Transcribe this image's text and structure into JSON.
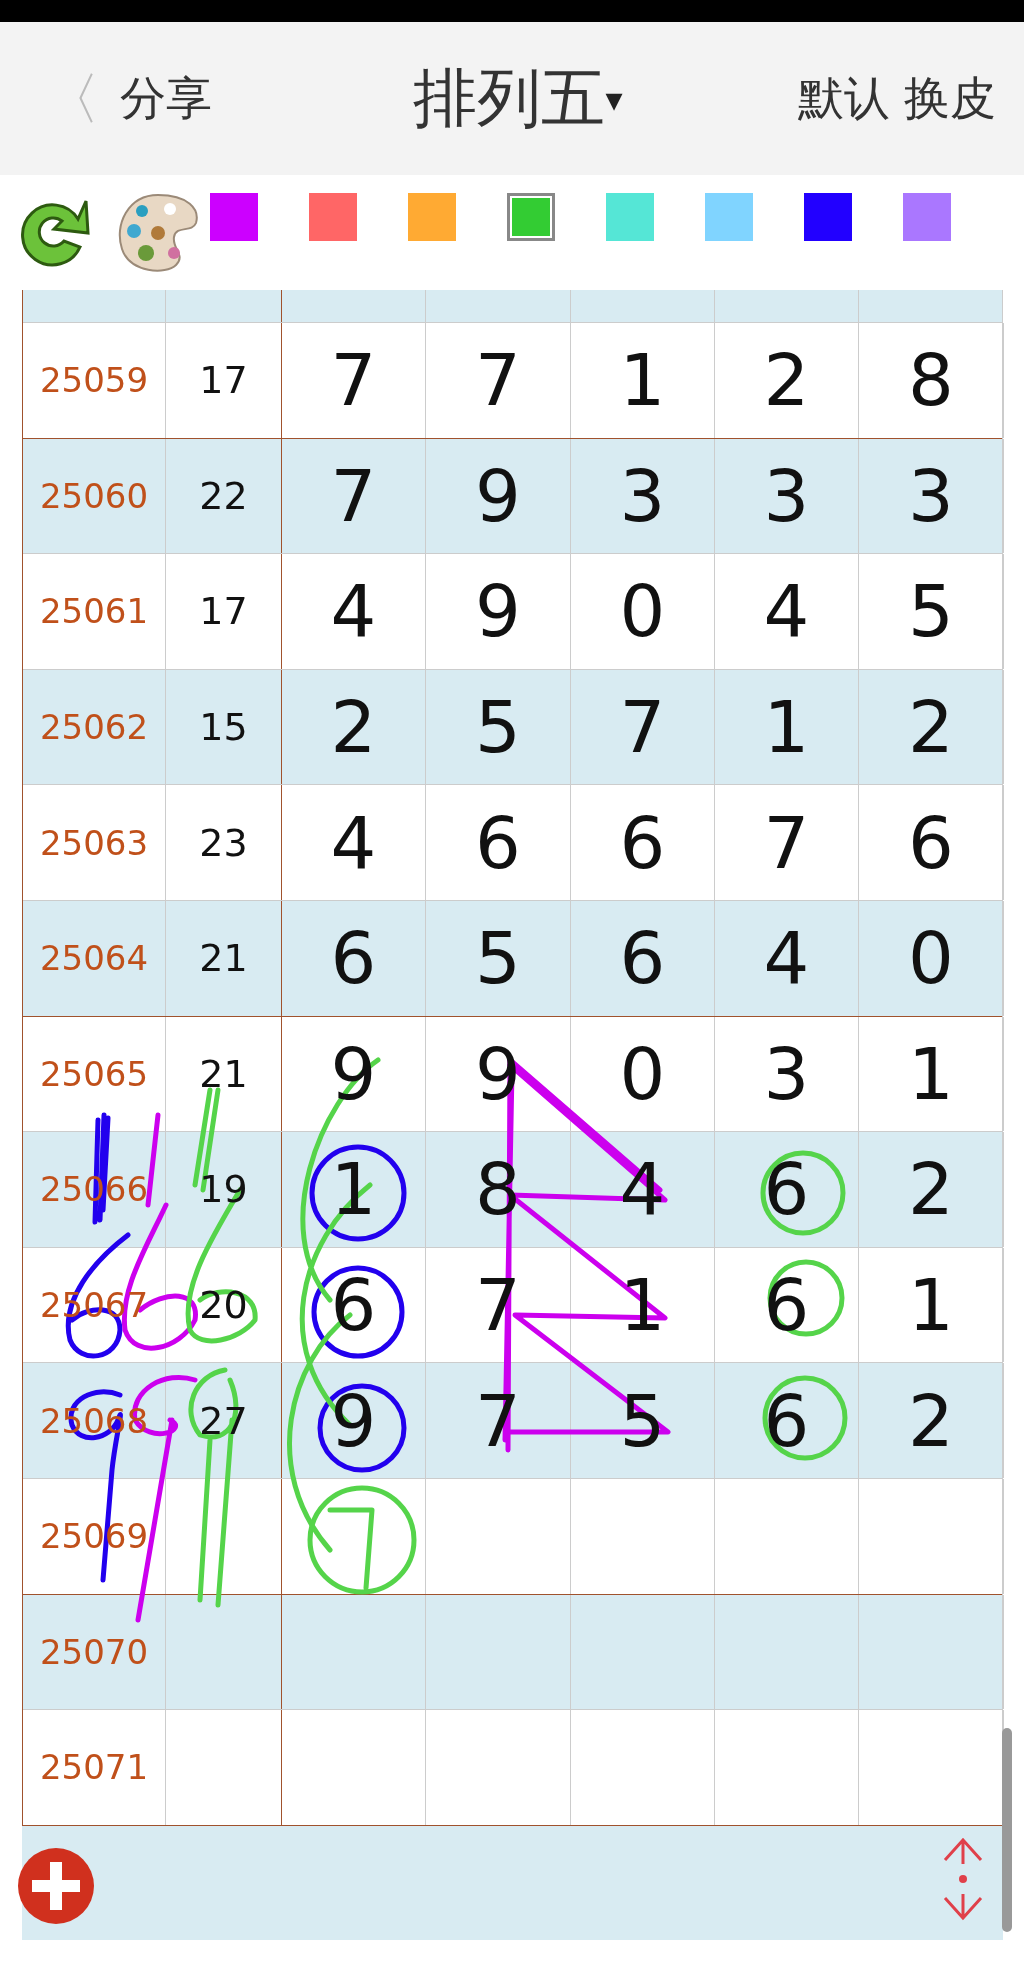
{
  "header": {
    "back": "〈",
    "share": "分享",
    "title": "排列五",
    "title_caret": "▾",
    "actions": [
      "默认",
      "换皮"
    ]
  },
  "palette": [
    {
      "color": "#cc00ff",
      "selected": false
    },
    {
      "color": "#ff6666",
      "selected": false
    },
    {
      "color": "#ffaa33",
      "selected": false
    },
    {
      "color": "#33cc33",
      "selected": true
    },
    {
      "color": "#55e6d6",
      "selected": false
    },
    {
      "color": "#80d4ff",
      "selected": false
    },
    {
      "color": "#2200ff",
      "selected": false
    },
    {
      "color": "#aa77ff",
      "selected": false
    }
  ],
  "rows": [
    {
      "issue": "25059",
      "sum": "17",
      "digits": [
        "7",
        "7",
        "1",
        "2",
        "8"
      ]
    },
    {
      "issue": "25060",
      "sum": "22",
      "digits": [
        "7",
        "9",
        "3",
        "3",
        "3"
      ]
    },
    {
      "issue": "25061",
      "sum": "17",
      "digits": [
        "4",
        "9",
        "0",
        "4",
        "5"
      ]
    },
    {
      "issue": "25062",
      "sum": "15",
      "digits": [
        "2",
        "5",
        "7",
        "1",
        "2"
      ]
    },
    {
      "issue": "25063",
      "sum": "23",
      "digits": [
        "4",
        "6",
        "6",
        "7",
        "6"
      ]
    },
    {
      "issue": "25064",
      "sum": "21",
      "digits": [
        "6",
        "5",
        "6",
        "4",
        "0"
      ]
    },
    {
      "issue": "25065",
      "sum": "21",
      "digits": [
        "9",
        "9",
        "0",
        "3",
        "1"
      ]
    },
    {
      "issue": "25066",
      "sum": "19",
      "digits": [
        "1",
        "8",
        "4",
        "6",
        "2"
      ]
    },
    {
      "issue": "25067",
      "sum": "20",
      "digits": [
        "6",
        "7",
        "1",
        "6",
        "1"
      ]
    },
    {
      "issue": "25068",
      "sum": "27",
      "digits": [
        "9",
        "7",
        "5",
        "6",
        "2"
      ]
    },
    {
      "issue": "25069"
    },
    {
      "issue": "25070"
    },
    {
      "issue": "25071"
    }
  ]
}
